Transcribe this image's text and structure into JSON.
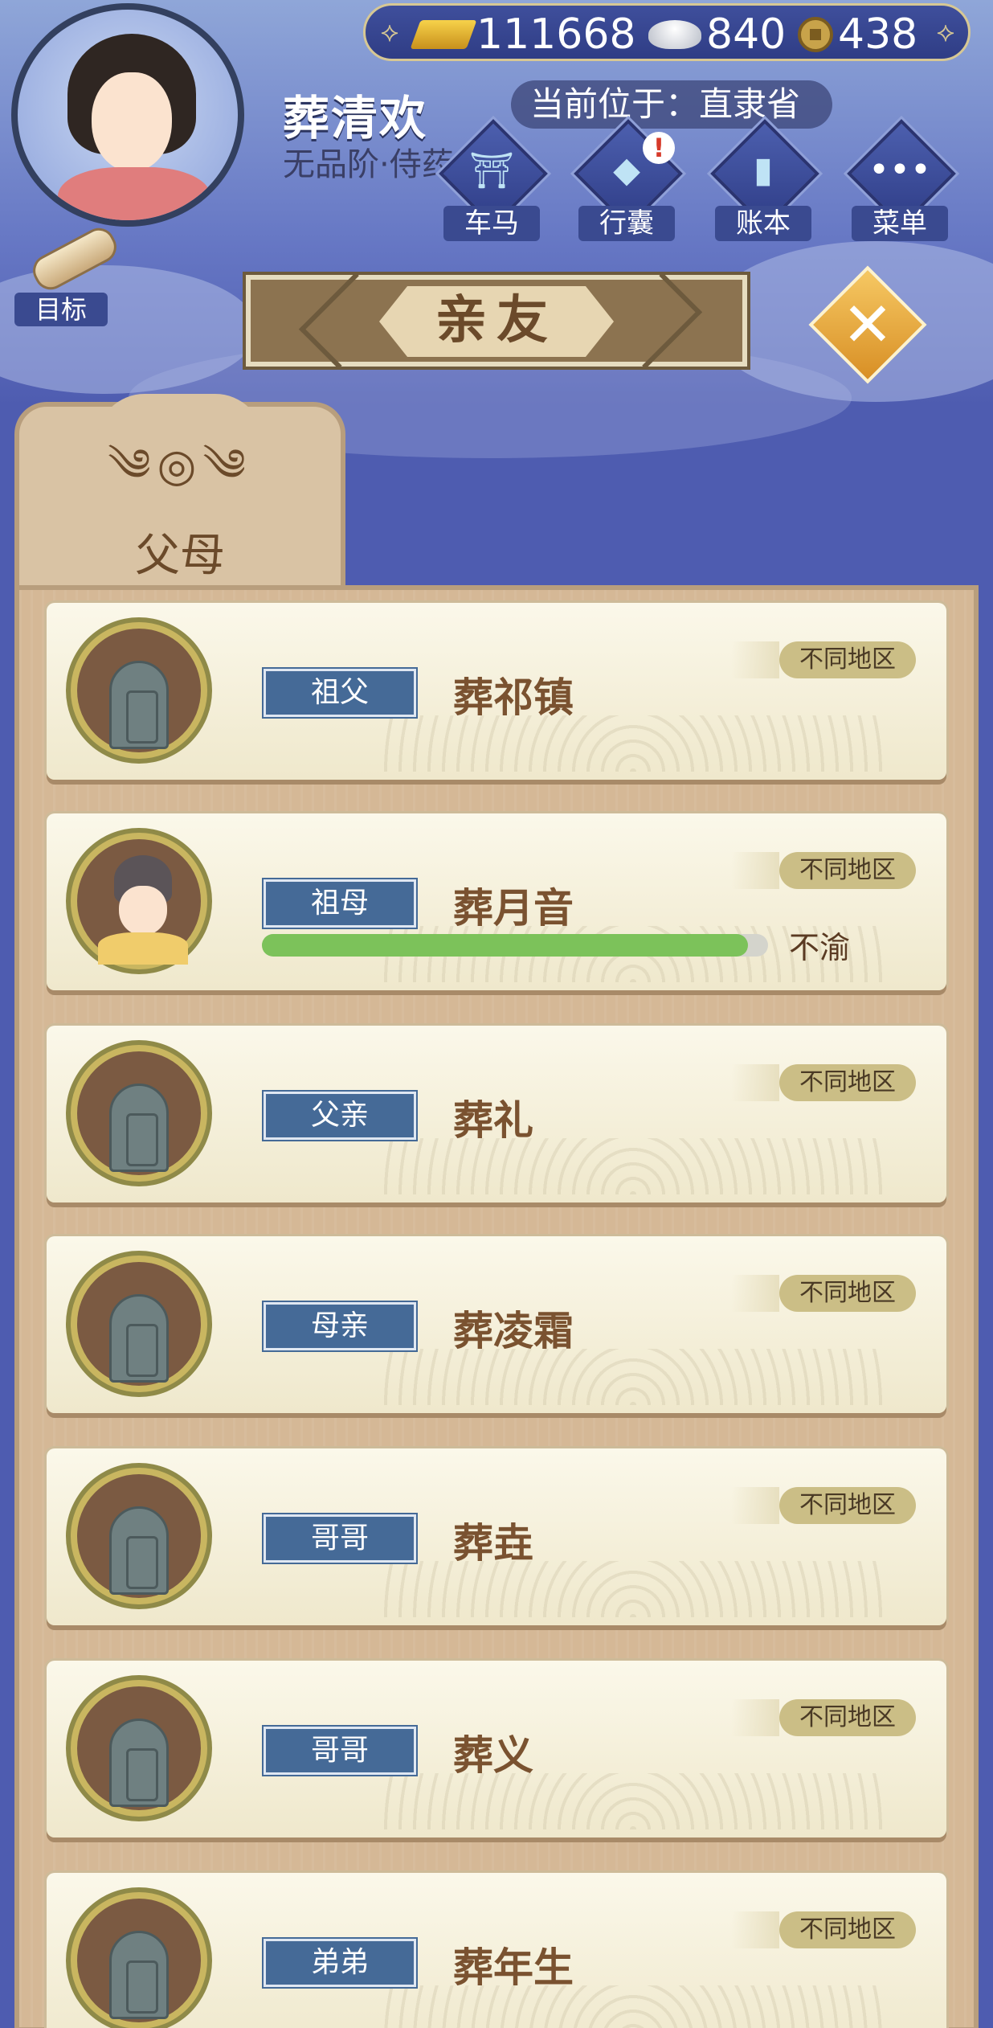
{
  "player": {
    "name": "葬清欢",
    "rank": "无品阶·侍药"
  },
  "currency": {
    "gold": "111668",
    "silver": "840",
    "coin": "438"
  },
  "location": "当前位于：直隶省",
  "nav": [
    {
      "label": "车马",
      "icon": "carriage-icon"
    },
    {
      "label": "行囊",
      "icon": "bag-icon",
      "alert": "!"
    },
    {
      "label": "账本",
      "icon": "ledger-icon"
    },
    {
      "label": "菜单",
      "icon": "menu-icon"
    }
  ],
  "target_label": "目标",
  "title": "亲友",
  "tab": {
    "label": "父母"
  },
  "relatives": [
    {
      "role": "祖父",
      "name": "葬祁镇",
      "region": "不同地区",
      "portrait": "tombstone"
    },
    {
      "role": "祖母",
      "name": "葬月音",
      "region": "不同地区",
      "portrait": "grandmother",
      "health_label": "不渝",
      "health": 0.96
    },
    {
      "role": "父亲",
      "name": "葬礼",
      "region": "不同地区",
      "portrait": "tombstone"
    },
    {
      "role": "母亲",
      "name": "葬凌霜",
      "region": "不同地区",
      "portrait": "tombstone"
    },
    {
      "role": "哥哥",
      "name": "葬垚",
      "region": "不同地区",
      "portrait": "tombstone"
    },
    {
      "role": "哥哥",
      "name": "葬义",
      "region": "不同地区",
      "portrait": "tombstone"
    },
    {
      "role": "弟弟",
      "name": "葬年生",
      "region": "不同地区",
      "portrait": "tombstone"
    }
  ]
}
